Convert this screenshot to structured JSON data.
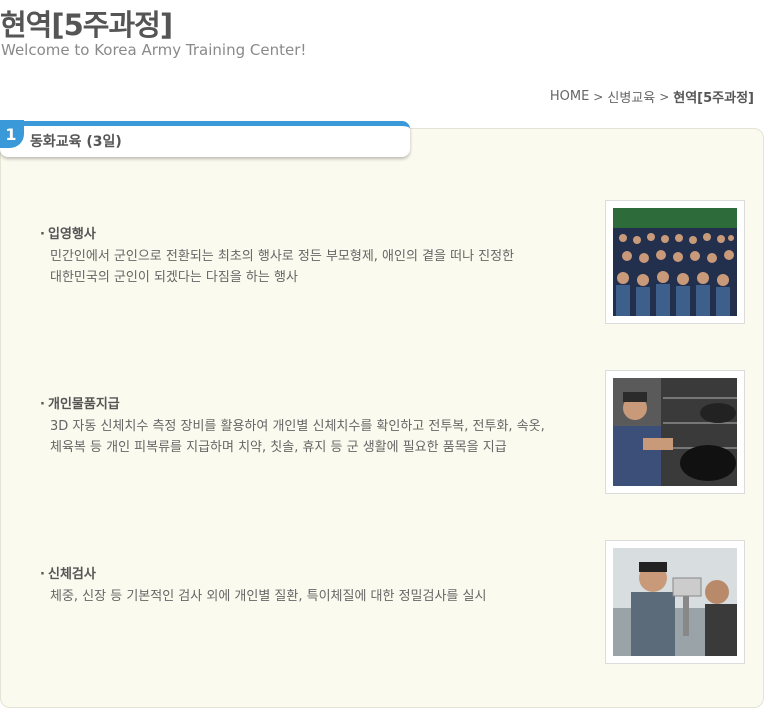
{
  "header": {
    "title": "현역[5주과정]",
    "subtitle": "Welcome to Korea Army Training Center!"
  },
  "breadcrumb": {
    "items": [
      "HOME",
      "신병교육"
    ],
    "current": "현역[5주과정]",
    "separator": ">"
  },
  "section": {
    "number": "1",
    "title": "동화교육 (3일)",
    "accent_color": "#3a9ad9"
  },
  "items": [
    {
      "title": "입영행사",
      "desc_lines": [
        "민간인에서 군인으로 전환되는 최초의 행사로 정든 부모형제, 애인의 곁을 떠나 진정한",
        "대한민국의 군인이 되겠다는 다짐을 하는 행사"
      ]
    },
    {
      "title": "개인물품지급",
      "desc_lines": [
        "3D 자동 신체치수 측정 장비를 활용하여 개인별 신체치수를 확인하고 전투복, 전투화, 속옷,",
        "체육복 등 개인 피복류를 지급하며 치약, 칫솔, 휴지 등 군 생활에 필요한 품목을 지급"
      ]
    },
    {
      "title": "신체검사",
      "desc_lines": [
        "체중, 신장 등 기본적인 검사 외에 개인별 질환, 특이체질에 대한 정밀검사를 실시"
      ]
    }
  ]
}
